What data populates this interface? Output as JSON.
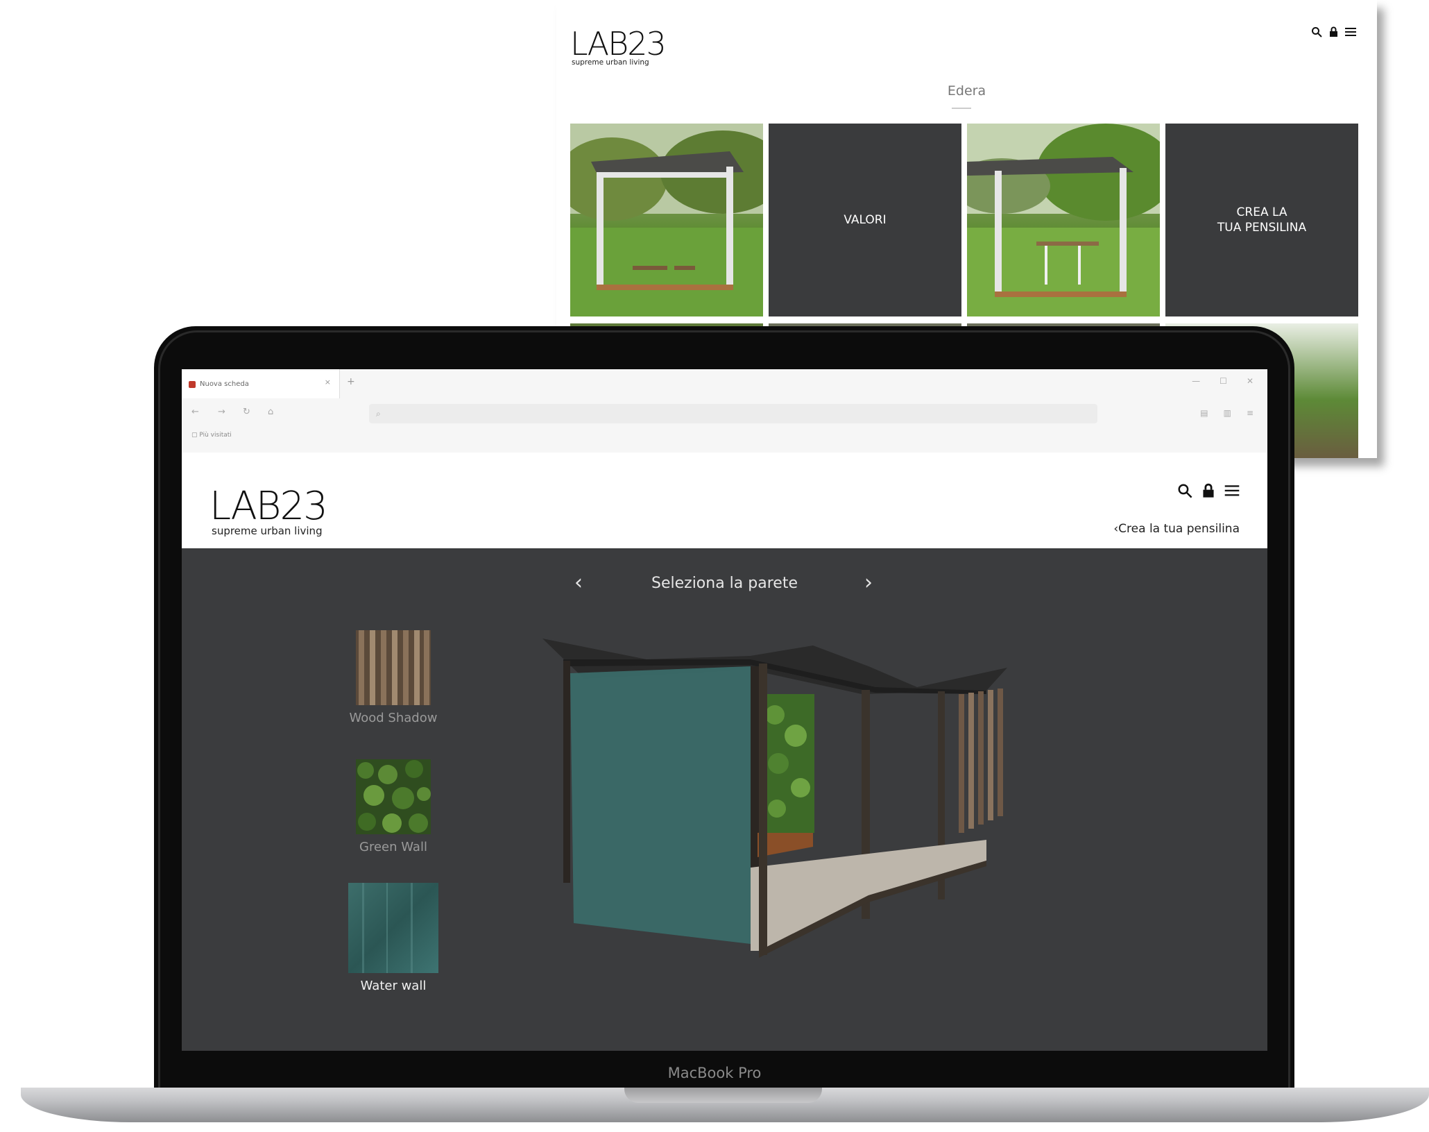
{
  "background_site": {
    "logo": {
      "text": "LAB23",
      "tagline": "supreme urban living"
    },
    "icons": [
      "search-icon",
      "lock-icon",
      "menu-icon"
    ],
    "section_title": "Edera",
    "tiles": [
      {
        "type": "photo",
        "label": ""
      },
      {
        "type": "text",
        "label": "VALORI"
      },
      {
        "type": "photo",
        "label": ""
      },
      {
        "type": "text",
        "label_line1": "CREA LA",
        "label_line2": "TUA PENSILINA"
      }
    ]
  },
  "laptop": {
    "model_label": "MacBook Pro",
    "browser": {
      "tab_title": "Nuova scheda",
      "tab_close": "×",
      "new_tab": "+",
      "address_placeholder": "",
      "bookmark_label": "Più visitati"
    },
    "site": {
      "logo": {
        "text": "LAB23",
        "tagline": "supreme urban living"
      },
      "icons": [
        "search-icon",
        "lock-icon",
        "menu-icon"
      ],
      "back_link": "Crea la tua pensilina",
      "configurator": {
        "title": "Seleziona la parete",
        "prev_arrow": "‹",
        "next_arrow": "›",
        "options": [
          {
            "label": "Wood Shadow",
            "selected": false
          },
          {
            "label": "Green Wall",
            "selected": false
          },
          {
            "label": "Water wall",
            "selected": true
          }
        ]
      }
    }
  },
  "colors": {
    "configurator_bg": "#3b3c3e",
    "tile_dark": "#3a3b3d",
    "water_wall": "#2f5a5a",
    "green_wall": "#3f6b2a"
  }
}
